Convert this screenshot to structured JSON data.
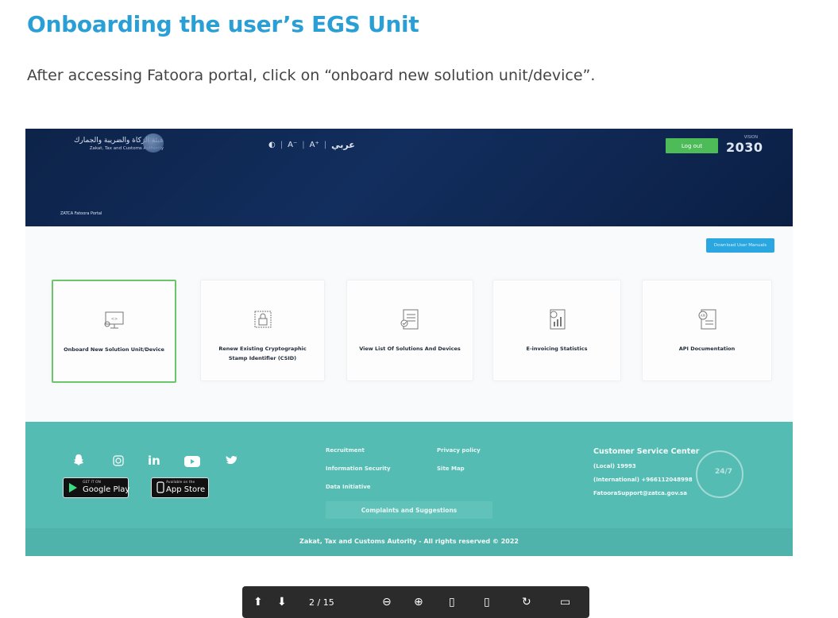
{
  "document": {
    "title": "Onboarding the user’s EGS Unit",
    "instruction": "After accessing Fatoora portal, click on “onboard new solution unit/device”."
  },
  "portal": {
    "header": {
      "logo_arabic": "هيئة الزكاة والضريبة والجمارك",
      "logo_english": "Zakat, Tax and Customs Authority",
      "contrast_icon": "contrast-icon",
      "font_decrease": "A⁻",
      "font_increase": "A⁺",
      "language_toggle": "عربي",
      "logout_label": "Log out",
      "vision_top": "VISION",
      "vision_number": "2030",
      "portal_name": "ZATCA Fatoora Portal"
    },
    "download_button": "Download User Manuals",
    "cards": [
      {
        "label": "Onboard New Solution Unit/Device",
        "icon": "monitor-settings-icon",
        "selected": true
      },
      {
        "label": "Renew Existing Cryptographic Stamp Identifier (CSID)",
        "icon": "lock-certificate-icon",
        "selected": false
      },
      {
        "label": "View List Of Solutions And Devices",
        "icon": "checklist-document-icon",
        "selected": false
      },
      {
        "label": "E-invoicing Statistics",
        "icon": "statistics-document-icon",
        "selected": false
      },
      {
        "label": "API Documentation",
        "icon": "api-document-icon",
        "selected": false
      }
    ],
    "footer": {
      "social_icons": [
        "snapchat-icon",
        "instagram-icon",
        "linkedin-icon",
        "youtube-icon",
        "twitter-icon"
      ],
      "google_play_small": "GET IT ON",
      "google_play_big": "Google Play",
      "app_store_small": "Available on the",
      "app_store_big": "App Store",
      "links_col1": [
        "Recruitment",
        "Information Security",
        "Data Initiative"
      ],
      "links_col2": [
        "Privacy policy",
        "Site Map"
      ],
      "complaints_button": "Complaints and Suggestions",
      "csc_title": "Customer Service Center",
      "csc_local": "(Local) 19993",
      "csc_international": "(International) +966112048998",
      "csc_email": "FatooraSupport@zatca.gov.sa",
      "support_badge": "24/7",
      "copyright": "Zakat, Tax and Customs Autority - All rights reserved © 2022"
    }
  },
  "viewer_toolbar": {
    "page_indicator": "2 / 15"
  }
}
